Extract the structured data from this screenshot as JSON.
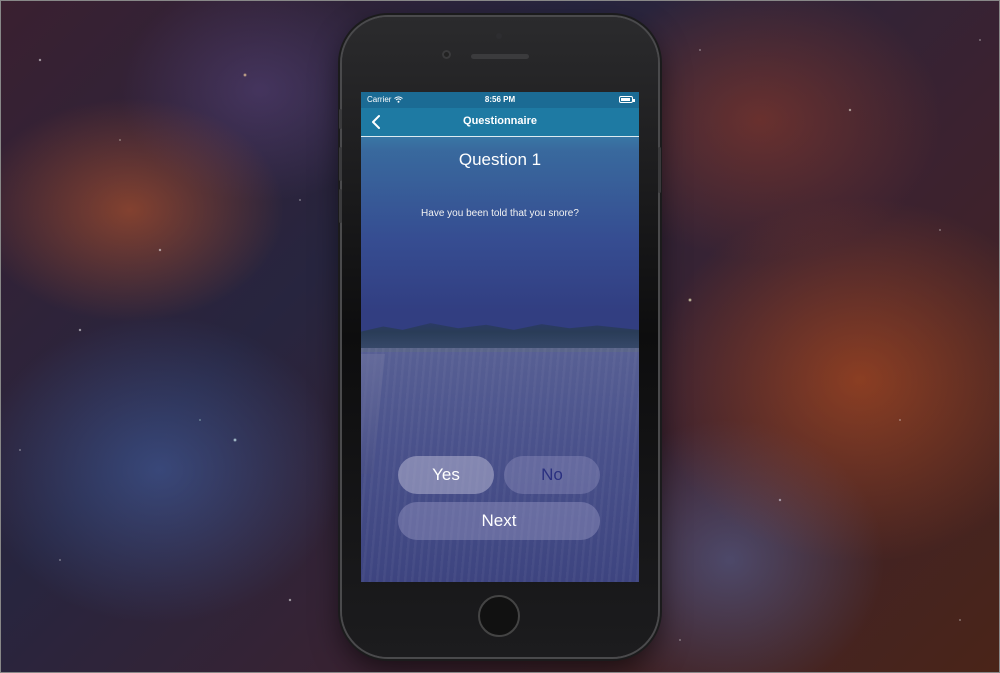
{
  "status_bar": {
    "carrier": "Carrier",
    "time": "8:56 PM",
    "battery_level": 0.85,
    "wifi_icon": "wifi-icon"
  },
  "nav": {
    "title": "Questionnaire",
    "back_icon": "chevron-left-icon"
  },
  "question": {
    "title": "Question 1",
    "text": "Have you been told that you snore?"
  },
  "answers": {
    "yes_label": "Yes",
    "no_label": "No",
    "next_label": "Next"
  },
  "colors": {
    "status_bar": "#1b6b94",
    "nav_bar": "#1e7aa3",
    "no_label_color": "#2a3080"
  }
}
